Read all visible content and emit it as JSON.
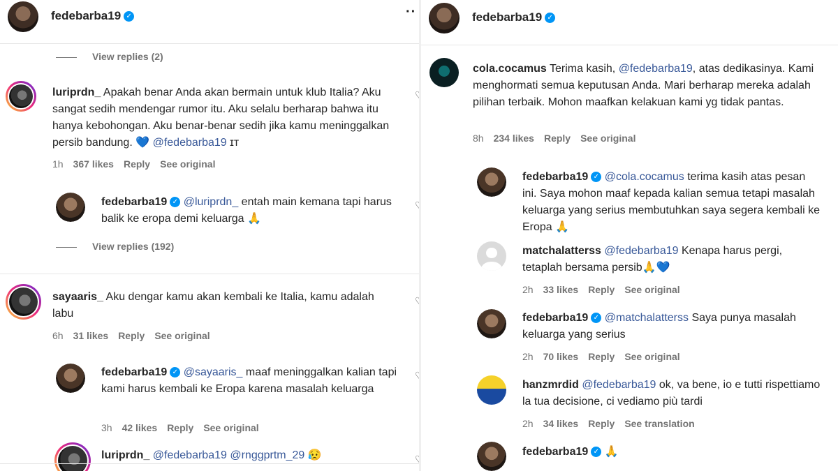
{
  "left": {
    "header_user": "fedebarba19",
    "more": "··",
    "view_replies_1": "View replies (2)",
    "view_replies_2": "View replies (192)",
    "c1": {
      "user": "luriprdn_",
      "text": "Apakah benar Anda akan bermain untuk klub Italia? Aku sangat sedih mendengar rumor itu. Aku selalu berharap bahwa itu hanya kebohongan. Aku benar-benar sedih jika kamu meninggalkan persib bandung.",
      "emoji": "💙",
      "mention": "@fedebarba19",
      "tail": "ɪᴛ",
      "time": "1h",
      "likes": "367 likes",
      "reply": "Reply",
      "see": "See original"
    },
    "r1": {
      "user": "fedebarba19",
      "mention": "@luriprdn_",
      "text": "entah main kemana tapi harus balik ke eropa demi keluarga",
      "emoji": "🙏"
    },
    "c2": {
      "user": "sayaaris_",
      "text": "Aku dengar kamu akan kembali ke Italia, kamu adalah labu",
      "time": "6h",
      "likes": "31 likes",
      "reply": "Reply",
      "see": "See original"
    },
    "r2": {
      "user": "fedebarba19",
      "mention": "@sayaaris_",
      "text": "maaf meninggalkan kalian tapi kami harus kembali ke Eropa karena masalah keluarga",
      "time": "3h",
      "likes": "42 likes",
      "reply": "Reply",
      "see": "See original"
    },
    "r3": {
      "user": "luriprdn_",
      "mention1": "@fedebarba19",
      "mention2": "@rnggprtm_29",
      "emoji": "😥"
    }
  },
  "right": {
    "header_user": "fedebarba19",
    "c1": {
      "user": "cola.cocamus",
      "pre": "Terima kasih,",
      "mention": "@fedebarba19",
      "text": ", atas dedikasinya. Kami menghormati semua keputusan Anda. Mari berharap mereka adalah pilihan terbaik. Mohon maafkan kelakuan kami yg tidak pantas.",
      "time": "8h",
      "likes": "234 likes",
      "reply": "Reply",
      "see": "See original"
    },
    "r1": {
      "user": "fedebarba19",
      "mention": "@cola.cocamus",
      "text": "terima kasih atas pesan ini. Saya mohon maaf kepada kalian semua tetapi masalah keluarga yang serius membutuhkan saya segera kembali ke Eropa",
      "emoji": "🙏"
    },
    "r2": {
      "user": "matchalatterss",
      "mention": "@fedebarba19",
      "text": "Kenapa harus pergi, tetaplah bersama persib",
      "emoji1": "🙏",
      "emoji2": "💙",
      "time": "2h",
      "likes": "33 likes",
      "reply": "Reply",
      "see": "See original"
    },
    "r3": {
      "user": "fedebarba19",
      "mention": "@matchalatterss",
      "text": "Saya punya masalah keluarga yang serius",
      "time": "2h",
      "likes": "70 likes",
      "reply": "Reply",
      "see": "See original"
    },
    "r4": {
      "user": "hanzmrdid",
      "mention": "@fedebarba19",
      "text": "ok, va bene, io e tutti rispettiamo la tua decisione, ci vediamo più tardi",
      "time": "2h",
      "likes": "34 likes",
      "reply": "Reply",
      "see": "See translation"
    },
    "r5": {
      "user": "fedebarba19",
      "emoji": "🙏"
    }
  },
  "icons": {
    "verified": "✓"
  },
  "colors": {
    "mention": "#385898",
    "verified": "#0095f6",
    "meta": "#737373"
  }
}
